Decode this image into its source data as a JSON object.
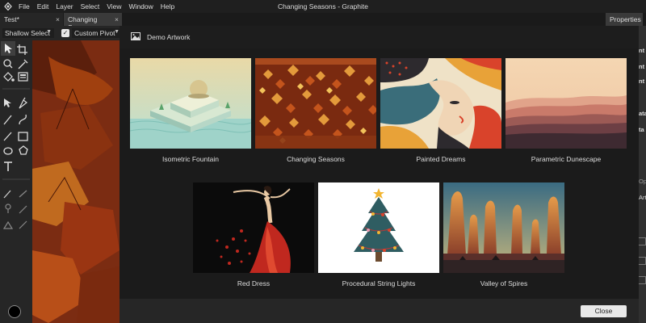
{
  "window": {
    "title": "Changing Seasons - Graphite"
  },
  "menu": [
    "File",
    "Edit",
    "Layer",
    "Select",
    "View",
    "Window",
    "Help"
  ],
  "tabs": [
    {
      "label": "Test*",
      "close": "×"
    },
    {
      "label": "Changing Seasons",
      "close": "×"
    }
  ],
  "properties_tab": "Properties",
  "options": {
    "select_mode": "Shallow Select",
    "pivot_checked": "✓",
    "pivot_label": "Custom Pivot"
  },
  "dialog": {
    "title": "Demo Artwork",
    "close_label": "Close",
    "artworks": [
      {
        "label": "Isometric Fountain",
        "icon": "isometric-fountain-thumbnail"
      },
      {
        "label": "Changing Seasons",
        "icon": "changing-seasons-thumbnail"
      },
      {
        "label": "Painted Dreams",
        "icon": "painted-dreams-thumbnail"
      },
      {
        "label": "Parametric Dunescape",
        "icon": "parametric-dunescape-thumbnail"
      },
      {
        "label": "Red Dress",
        "icon": "red-dress-thumbnail"
      },
      {
        "label": "Procedural String Lights",
        "icon": "procedural-string-lights-thumbnail"
      },
      {
        "label": "Valley of Spires",
        "icon": "valley-of-spires-thumbnail"
      }
    ]
  },
  "right_panel": {
    "fragments": [
      "nt",
      "nt",
      "nt",
      "ata",
      "ta",
      "Op",
      "Art"
    ]
  },
  "colors": {
    "menubar": "#1f1f1f",
    "dialog_body": "#1b1b1b",
    "canvas_leaf": "#a33a14"
  }
}
